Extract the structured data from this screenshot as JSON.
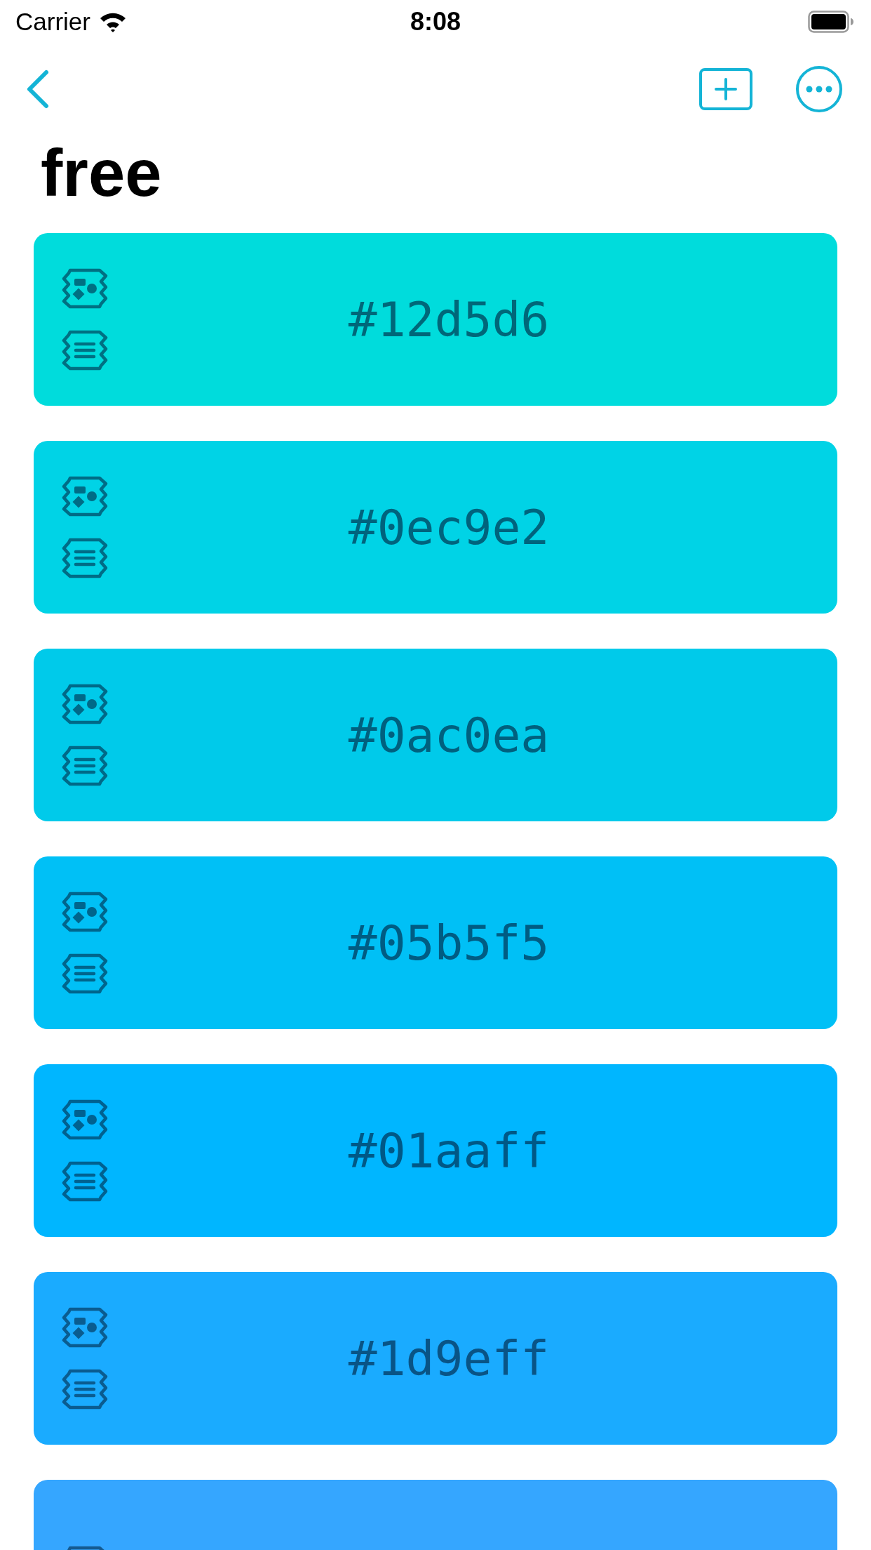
{
  "status_bar": {
    "carrier": "Carrier",
    "time": "8:08"
  },
  "title": "free",
  "cards": [
    {
      "label": "#12d5d6",
      "color": "#00dcdc"
    },
    {
      "label": "#0ec9e2",
      "color": "#00d3e6"
    },
    {
      "label": "#0ac0ea",
      "color": "#00caea"
    },
    {
      "label": "#05b5f5",
      "color": "#00c0f6"
    },
    {
      "label": "#01aaff",
      "color": "#00b6ff"
    },
    {
      "label": "#1d9eff",
      "color": "#1aabff"
    },
    {
      "color": "#35a6ff"
    }
  ]
}
